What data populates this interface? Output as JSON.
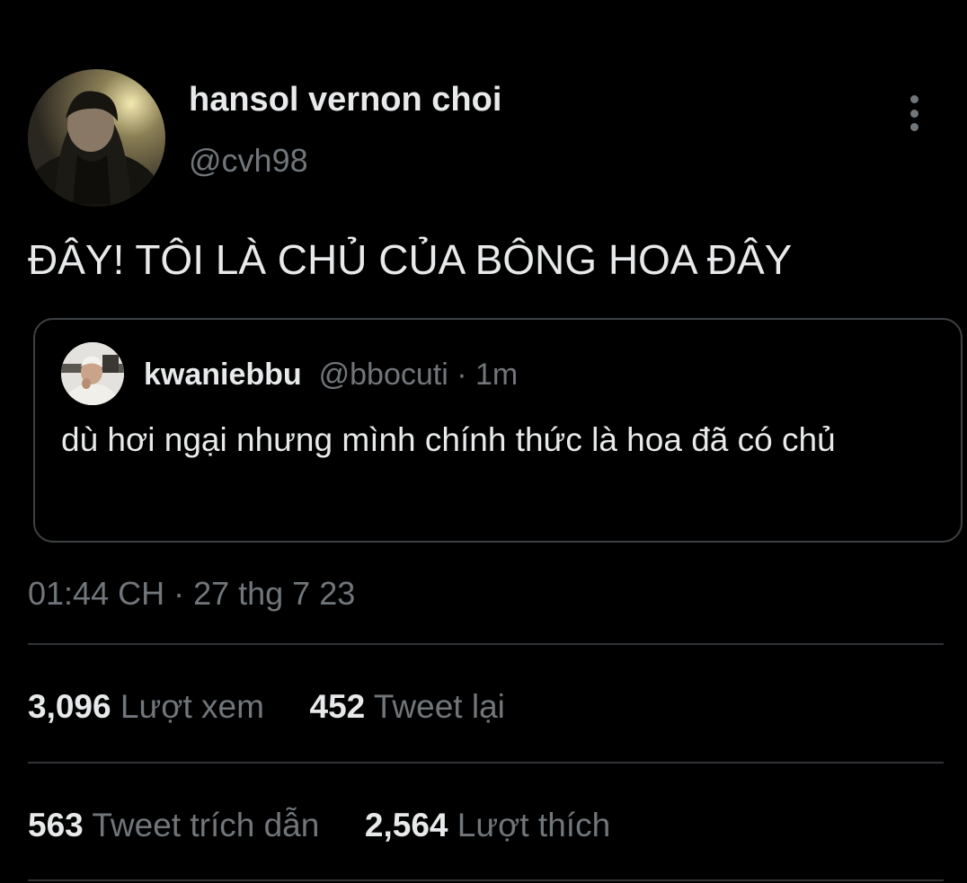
{
  "author": {
    "display_name": "hansol vernon choi",
    "handle": "@cvh98"
  },
  "tweet": {
    "text": "ĐÂY! TÔI LÀ CHỦ CỦA BÔNG HOA ĐÂY",
    "timestamp": "01:44 CH · 27 thg 7 23"
  },
  "quoted_tweet": {
    "display_name": "kwaniebbu",
    "handle": "@bbocuti",
    "separator": " · ",
    "age": "1m",
    "text": "dù hơi ngại nhưng mình chính thức là hoa đã có chủ"
  },
  "stats": {
    "views": {
      "count": "3,096",
      "label": "Lượt xem"
    },
    "retweets": {
      "count": "452",
      "label": "Tweet lại"
    },
    "quotes": {
      "count": "563",
      "label": "Tweet trích dẫn"
    },
    "likes": {
      "count": "2,564",
      "label": "Lượt thích"
    }
  },
  "icons": {
    "more": "more-vertical-icon"
  },
  "colors": {
    "background": "#000000",
    "primary_text": "#e7e9ea",
    "secondary_text": "#71767b",
    "divider": "#2f3336",
    "card_border": "#3e4144"
  }
}
